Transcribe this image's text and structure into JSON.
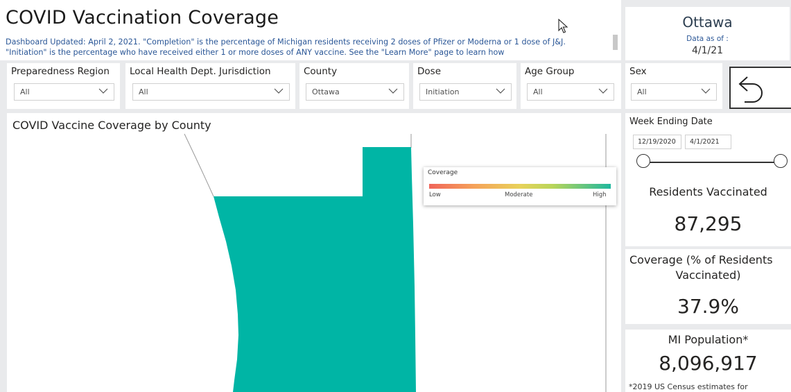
{
  "header": {
    "title": "COVID Vaccination Coverage",
    "description": "Dashboard Updated: April 2, 2021. \"Completion\" is the percentage of Michigan residents receiving 2 doses of Pfizer or Moderna or 1 dose of J&J. \"Initiation\" is the percentage who have received either 1 or more doses of ANY vaccine. See the \"Learn More\" page to learn how"
  },
  "location_card": {
    "name": "Ottawa",
    "data_as_of_label": "Data as of :",
    "data_as_of_value": "4/1/21"
  },
  "filters": [
    {
      "label": "Preparedness Region",
      "value": "All"
    },
    {
      "label": "Local Health Dept. Jurisdiction",
      "value": "All"
    },
    {
      "label": "County",
      "value": "Ottawa"
    },
    {
      "label": "Dose",
      "value": "Initiation"
    },
    {
      "label": "Age Group",
      "value": "All"
    },
    {
      "label": "Sex",
      "value": "All"
    }
  ],
  "map": {
    "title": "COVID Vaccine Coverage by County",
    "fill_color": "#00b5a5",
    "legend": {
      "title": "Coverage",
      "low": "Low",
      "moderate": "Moderate",
      "high": "High"
    }
  },
  "date_slicer": {
    "label": "Week Ending Date",
    "start": "12/19/2020",
    "end": "4/1/2021"
  },
  "kpis": {
    "residents_label": "Residents Vaccinated",
    "residents_value": "87,295",
    "coverage_label_line1": "Coverage (% of Residents",
    "coverage_label_line2": "Vaccinated)",
    "coverage_value": "37.9%",
    "population_label": "MI Population*",
    "population_value": "8,096,917",
    "footnote": "*2019 US Census estimates for"
  },
  "icons": {
    "back": "back-arrow-icon",
    "cursor": "mouse-cursor-icon",
    "chevron": "chevron-down-icon"
  }
}
